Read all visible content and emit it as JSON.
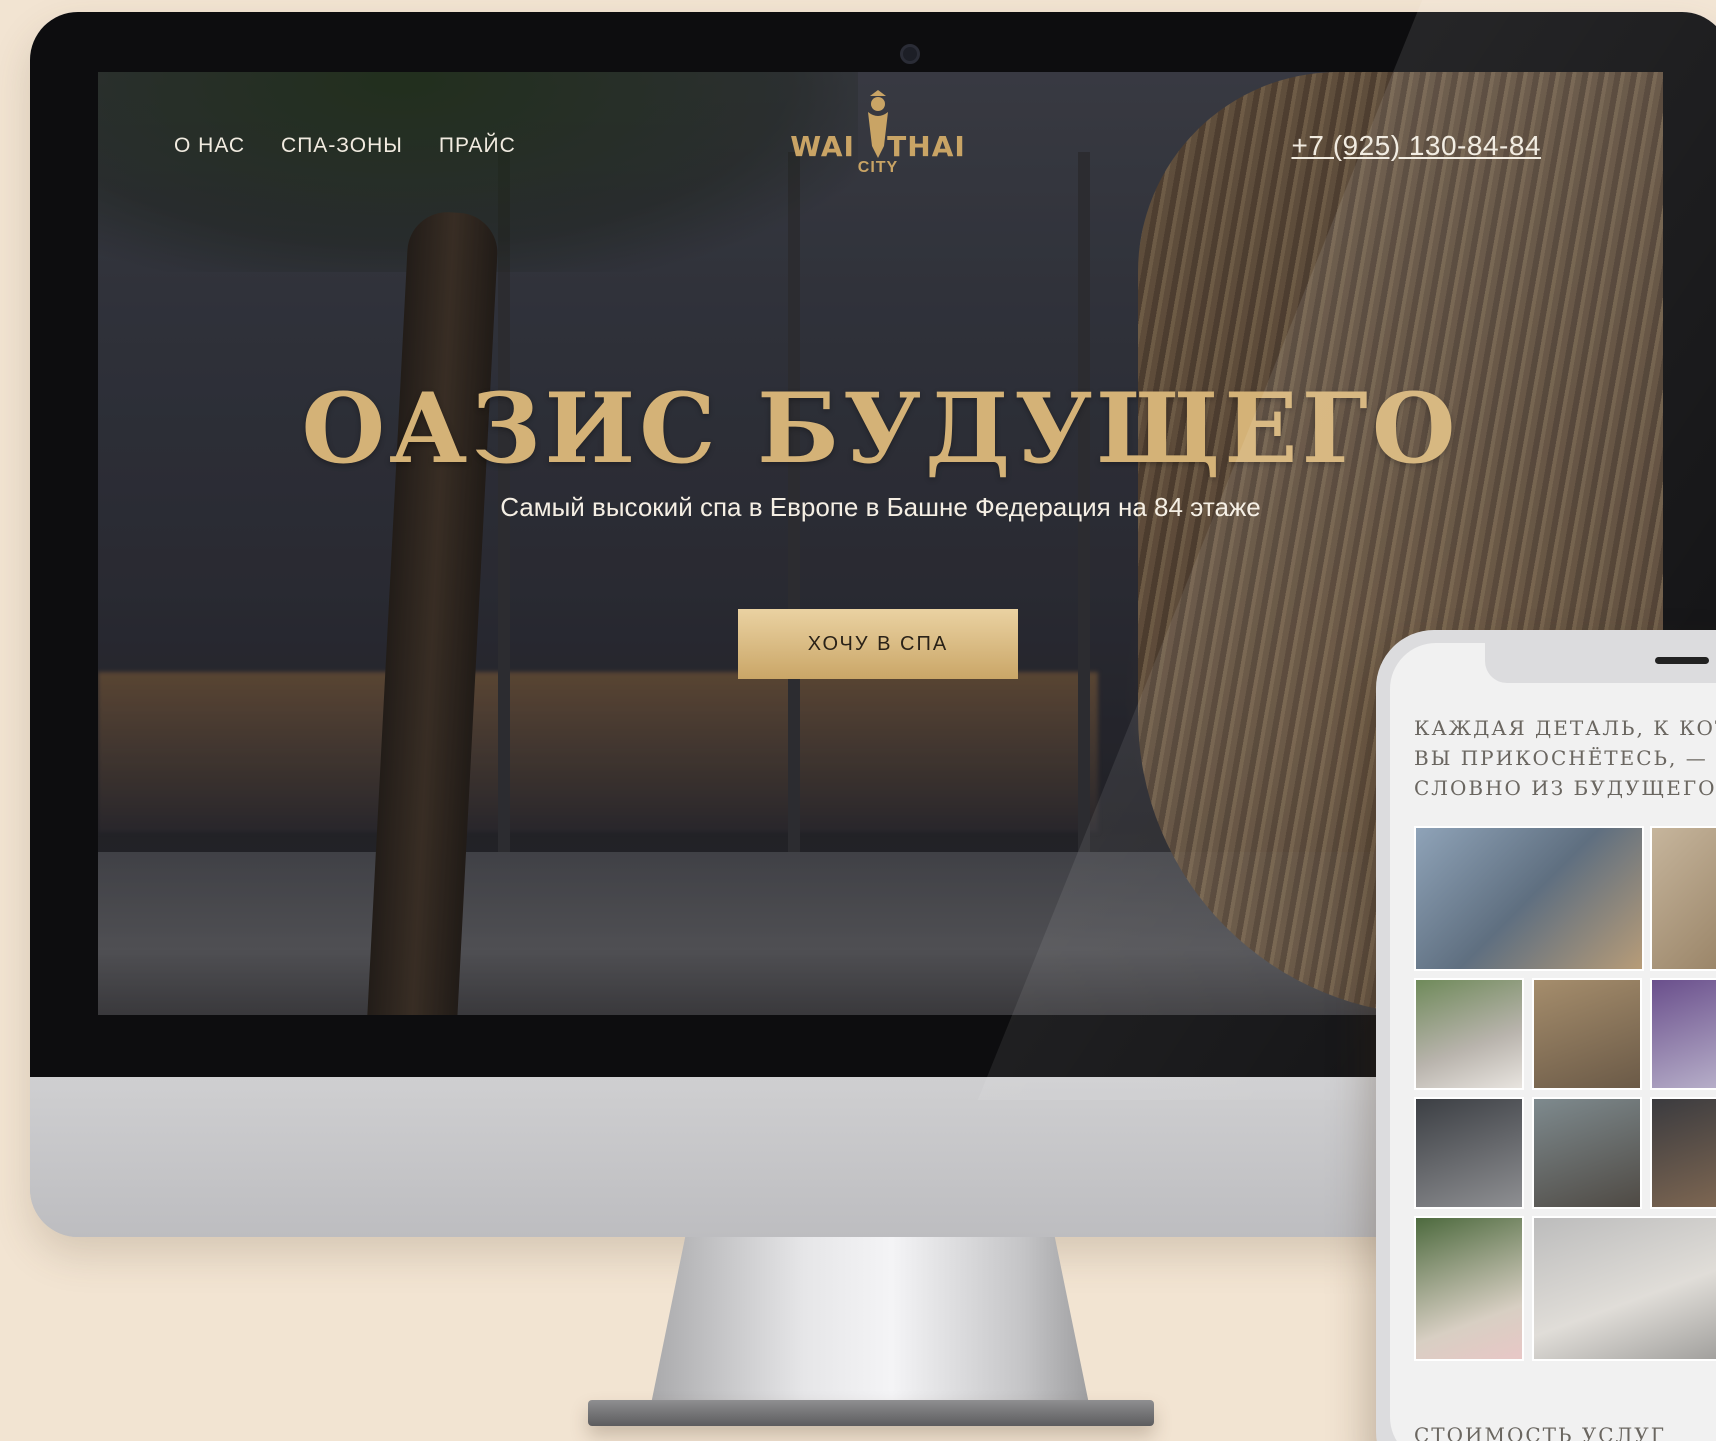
{
  "site": {
    "nav": [
      "О НАС",
      "СПА-ЗОНЫ",
      "ПРАЙС"
    ],
    "logo": {
      "wordmark_left": "WAI",
      "wordmark_right": "THAI",
      "sub": "CITY"
    },
    "phone": "+7 (925) 130-84-84",
    "hero_title": "ОАЗИС БУДУЩЕГО",
    "hero_subtitle": "Самый высокий спа в Европе в Башне Федерация на 84 этаже",
    "cta_label": "ХОЧУ В СПА"
  },
  "mobile": {
    "heading_lines": [
      "КАЖДАЯ ДЕТАЛЬ, К КОТОР",
      "ВЫ ПРИКОСНЁТЕСЬ, — БУД",
      "СЛОВНО ИЗ БУДУЩЕГО"
    ],
    "footer_heading": "СТОИМОСТЬ УСЛУГ"
  },
  "colors": {
    "background": "#f2e4d2",
    "accent_gold": "#c9a465",
    "hero_title": "#d4b277",
    "cta": "#ead2a2"
  }
}
